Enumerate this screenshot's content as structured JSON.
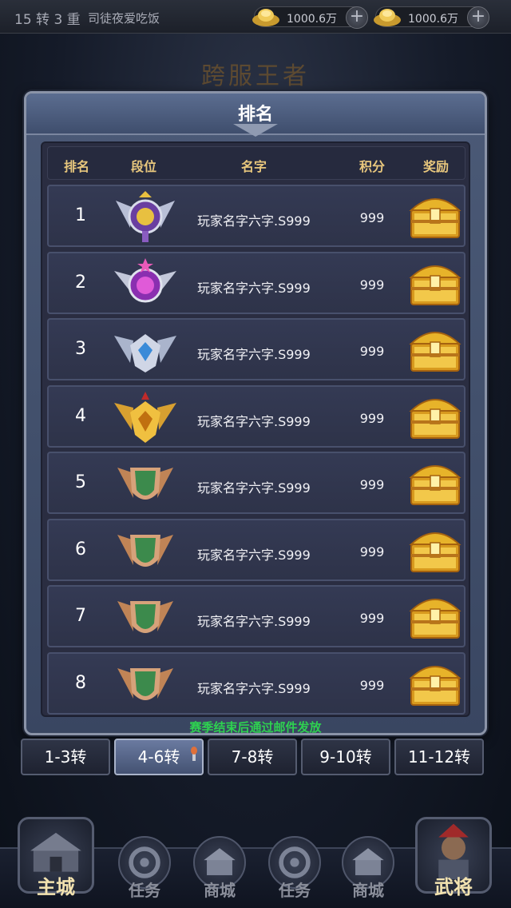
{
  "status_bar": {
    "level_text": "15 转 3 重",
    "player_name": "司徒夜爱吃饭",
    "currencies": [
      {
        "icon": "gold-ingot-icon",
        "amount": "1000.6万"
      },
      {
        "icon": "gold-ingot-icon",
        "amount": "1000.6万"
      }
    ]
  },
  "background_title": "跨服王者",
  "panel": {
    "title": "排名",
    "columns": [
      "排名",
      "段位",
      "名字",
      "积分",
      "奖励"
    ],
    "rows": [
      {
        "rank": "1",
        "tier_icon": "amethyst-winged-badge-icon",
        "name": "玩家名字六字.S999",
        "score": "999",
        "reward_icon": "gold-chest-icon"
      },
      {
        "rank": "2",
        "tier_icon": "purple-star-winged-badge-icon",
        "name": "玩家名字六字.S999",
        "score": "999",
        "reward_icon": "gold-chest-icon"
      },
      {
        "rank": "3",
        "tier_icon": "blue-diamond-winged-badge-icon",
        "name": "玩家名字六字.S999",
        "score": "999",
        "reward_icon": "gold-chest-icon"
      },
      {
        "rank": "4",
        "tier_icon": "gold-winged-badge-icon",
        "name": "玩家名字六字.S999",
        "score": "999",
        "reward_icon": "gold-chest-icon"
      },
      {
        "rank": "5",
        "tier_icon": "green-bronze-shield-icon",
        "name": "玩家名字六字.S999",
        "score": "999",
        "reward_icon": "gold-chest-icon"
      },
      {
        "rank": "6",
        "tier_icon": "green-bronze-shield-icon",
        "name": "玩家名字六字.S999",
        "score": "999",
        "reward_icon": "gold-chest-icon"
      },
      {
        "rank": "7",
        "tier_icon": "green-bronze-shield-icon",
        "name": "玩家名字六字.S999",
        "score": "999",
        "reward_icon": "gold-chest-icon"
      },
      {
        "rank": "8",
        "tier_icon": "green-bronze-shield-icon",
        "name": "玩家名字六字.S999",
        "score": "999",
        "reward_icon": "gold-chest-icon"
      }
    ],
    "footer_note": "赛季结束后通过邮件发放"
  },
  "tabs": [
    {
      "label": "1-3转",
      "active": false
    },
    {
      "label": "4-6转",
      "active": true
    },
    {
      "label": "7-8转",
      "active": false
    },
    {
      "label": "9-10转",
      "active": false
    },
    {
      "label": "11-12转",
      "active": false
    }
  ],
  "bottom_nav": {
    "main_city": "主城",
    "items": [
      {
        "label": "任务",
        "icon": "swirl-icon"
      },
      {
        "label": "商城",
        "icon": "shop-icon"
      },
      {
        "label": "任务",
        "icon": "swirl-icon"
      },
      {
        "label": "商城",
        "icon": "shop-icon"
      }
    ],
    "general": "武将"
  },
  "colors": {
    "header_gold": "#e8c77d",
    "note_green": "#2ed150",
    "panel_blue": "#4b5a77",
    "row_bg": "#343a54"
  }
}
